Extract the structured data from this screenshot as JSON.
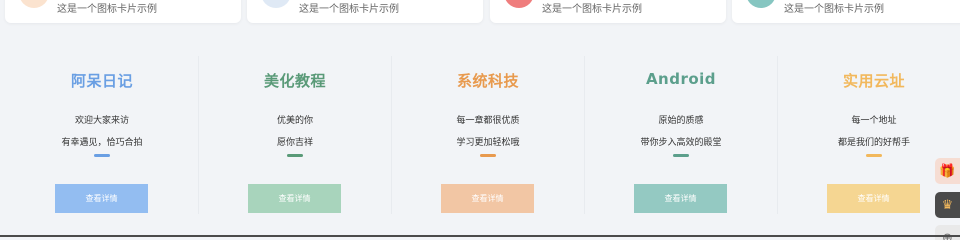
{
  "top_cards": [
    {
      "description": "这是一个图标卡片示例",
      "color": "#fbe3cf"
    },
    {
      "description": "这是一个图标卡片示例",
      "color": "#dfe9f5"
    },
    {
      "description": "这是一个图标卡片示例",
      "color": "#ef7d7d"
    },
    {
      "description": "这是一个图标卡片示例",
      "color": "#86c6c1"
    }
  ],
  "features": [
    {
      "title": "阿呆日记",
      "line1": "欢迎大家来访",
      "line2": "有幸遇见，恰巧合拍",
      "button": "查看详情",
      "accent": "#6a9fe3",
      "button_color": "#93bdf1"
    },
    {
      "title": "美化教程",
      "line1": "优美的你",
      "line2": "愿你吉祥",
      "button": "查看详情",
      "accent": "#5a9a78",
      "button_color": "#a8d4bc"
    },
    {
      "title": "系统科技",
      "line1": "每一章都很优质",
      "line2": "学习更加轻松哦",
      "button": "查看详情",
      "accent": "#e89a4e",
      "button_color": "#f2c6a4"
    },
    {
      "title": "Android",
      "line1": "原始的质感",
      "line2": "带你步入高效的殿堂",
      "button": "查看详情",
      "accent": "#5c9f8c",
      "button_color": "#94c9c2"
    },
    {
      "title": "实用云址",
      "line1": "每一个地址",
      "line2": "都是我们的好帮手",
      "button": "查看详情",
      "accent": "#f2b85c",
      "button_color": "#f5d692"
    }
  ],
  "side_tools": [
    {
      "icon": "gift-icon",
      "glyph": "🎁",
      "color": "#f6ddd3"
    },
    {
      "icon": "crown-icon",
      "glyph": "♛",
      "color": "#4a4a4a"
    },
    {
      "icon": "add-icon",
      "glyph": "⊕",
      "color": "#e9e9e9"
    }
  ]
}
